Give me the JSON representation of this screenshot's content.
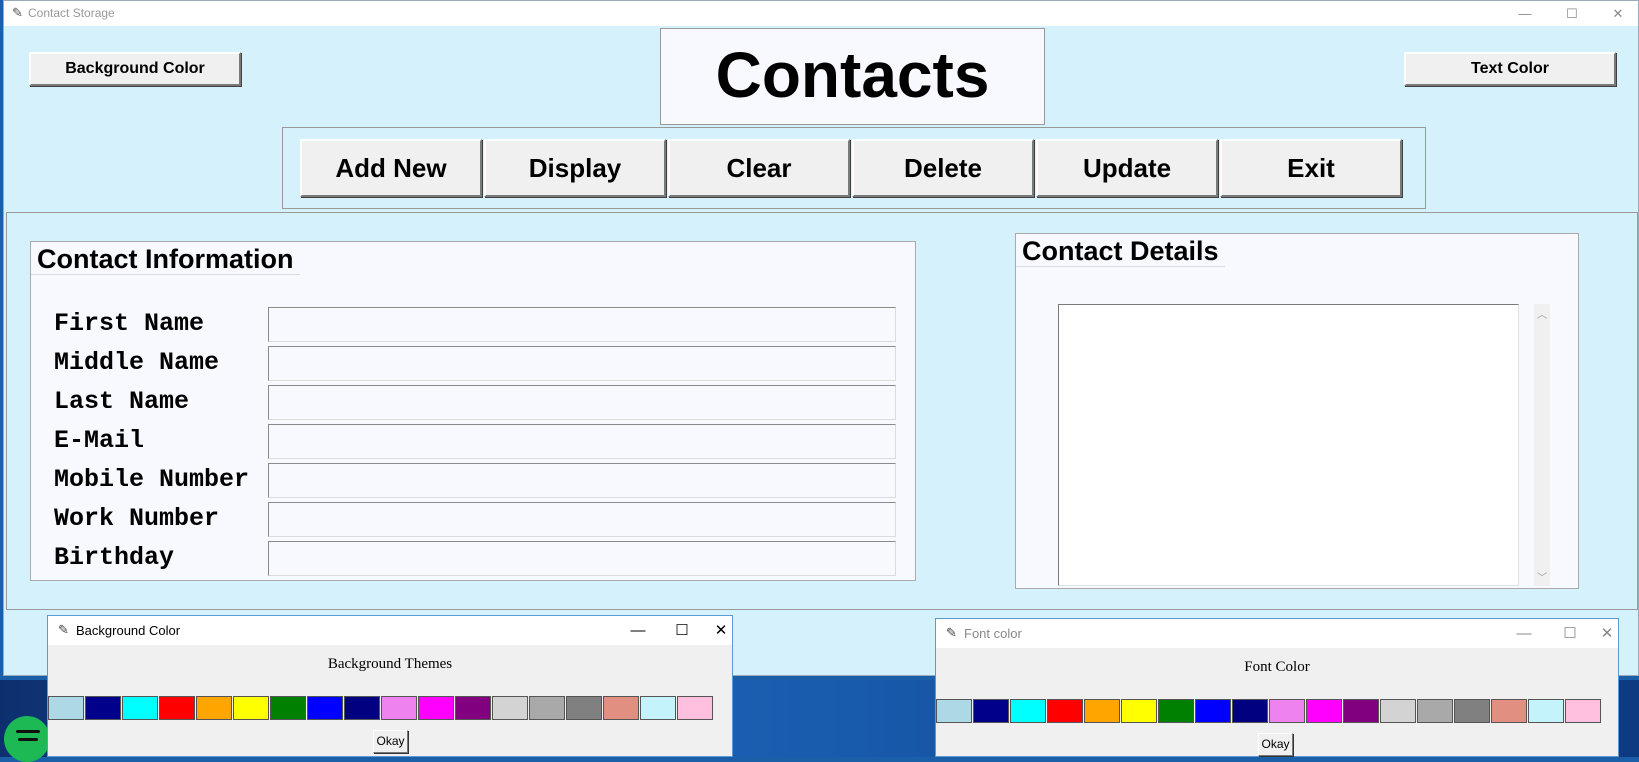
{
  "main_window": {
    "title": "Contact Storage",
    "controls": {
      "minimize": "—",
      "maximize": "☐",
      "close": "✕"
    }
  },
  "top_buttons": {
    "background_color": "Background Color",
    "text_color": "Text Color"
  },
  "header": {
    "title": "Contacts"
  },
  "toolbar": [
    {
      "label": "Add New"
    },
    {
      "label": "Display"
    },
    {
      "label": "Clear"
    },
    {
      "label": "Delete"
    },
    {
      "label": "Update"
    },
    {
      "label": "Exit"
    }
  ],
  "contact_info": {
    "title": "Contact Information",
    "fields": [
      {
        "label": "First Name",
        "value": ""
      },
      {
        "label": "Middle Name",
        "value": ""
      },
      {
        "label": "Last Name",
        "value": ""
      },
      {
        "label": "E-Mail",
        "value": ""
      },
      {
        "label": "Mobile Number",
        "value": ""
      },
      {
        "label": "Work Number",
        "value": ""
      },
      {
        "label": "Birthday",
        "value": ""
      }
    ]
  },
  "contact_details": {
    "title": "Contact Details",
    "content": ""
  },
  "bg_dialog": {
    "title": "Background Color",
    "heading": "Background Themes",
    "okay": "Okay",
    "controls": {
      "minimize": "—",
      "maximize": "☐",
      "close": "✕"
    }
  },
  "font_dialog": {
    "title": "Font color",
    "heading": "Font Color",
    "okay": "Okay",
    "controls": {
      "minimize": "—",
      "maximize": "☐",
      "close": "✕"
    }
  },
  "swatch_colors": [
    "#add8e6",
    "#00008b",
    "#00ffff",
    "#ff0000",
    "#ffa500",
    "#ffff00",
    "#008000",
    "#0000ff",
    "#000080",
    "#ee82ee",
    "#ff00ff",
    "#800080",
    "#d3d3d3",
    "#a9a9a9",
    "#808080",
    "#e08f80",
    "#c5f3fc",
    "#ffc0e0"
  ],
  "icons": {
    "app": "feather-icon",
    "taskbar": "spotify-icon"
  }
}
